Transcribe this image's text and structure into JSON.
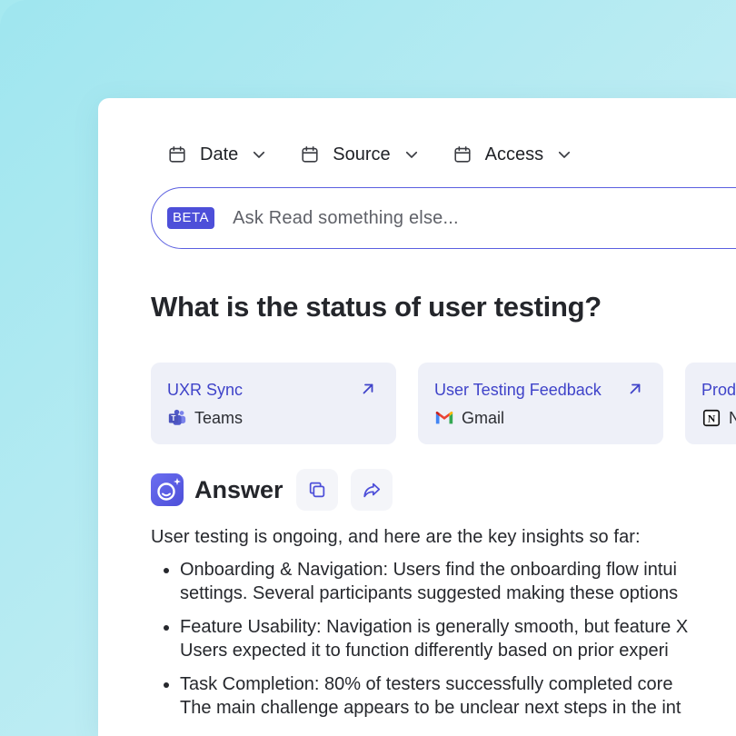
{
  "filters": [
    {
      "label": "Date",
      "icon": "calendar-icon"
    },
    {
      "label": "Source",
      "icon": "calendar-icon"
    },
    {
      "label": "Access",
      "icon": "calendar-icon"
    }
  ],
  "search": {
    "badge": "BETA",
    "placeholder": "Ask Read something else..."
  },
  "question": "What is the status of user testing?",
  "sources": [
    {
      "title": "UXR Sync",
      "app": "Teams",
      "app_icon": "teams-icon"
    },
    {
      "title": "User Testing Feedback",
      "app": "Gmail",
      "app_icon": "gmail-icon"
    },
    {
      "title": "Prod",
      "app": "N",
      "app_icon": "notion-icon"
    }
  ],
  "answer": {
    "title": "Answer",
    "intro": "User testing is ongoing, and here are the key insights so far:",
    "bullets": [
      "Onboarding & Navigation: Users find the onboarding flow intui\nsettings. Several participants suggested making these options",
      "Feature Usability: Navigation is generally smooth, but feature X\nUsers expected it to function differently based on prior experi",
      "Task Completion: 80% of testers successfully completed core\nThe main challenge appears to be unclear next steps in the int"
    ]
  },
  "colors": {
    "accent": "#4d4fd9",
    "link": "#3f43c9",
    "card_bg": "#eef0f8",
    "background": "#a5e9f0"
  }
}
